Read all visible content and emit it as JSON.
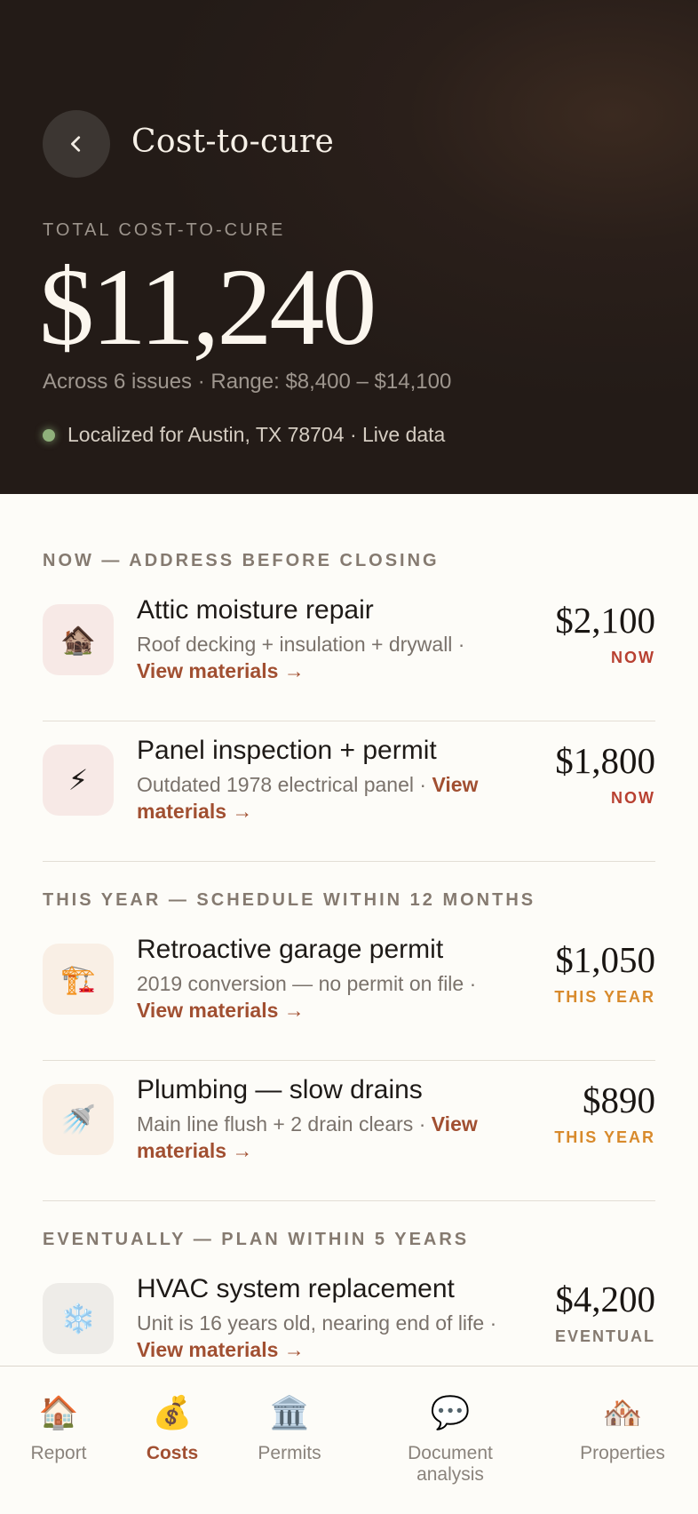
{
  "header": {
    "title": "Cost-to-cure",
    "total_label": "TOTAL COST-TO-CURE",
    "total_amount": "$11,240",
    "summary": "Across 6 issues · Range: $8,400 – $14,100",
    "location": "Localized for Austin, TX 78704 · Live data"
  },
  "sections": [
    {
      "heading": "NOW — ADDRESS BEFORE CLOSING"
    },
    {
      "heading": "THIS YEAR — SCHEDULE WITHIN 12 MONTHS"
    },
    {
      "heading": "EVENTUALLY — PLAN WITHIN 5 YEARS"
    }
  ],
  "items": [
    {
      "icon": "🏚️",
      "icon_name": "house-icon",
      "name": "Attic moisture repair",
      "description": "Roof decking + insulation + drywall ·",
      "link": "View materials →",
      "price": "$2,100",
      "timing": "NOW",
      "timing_color": "#b84031",
      "tile_color": "#f7e9e6"
    },
    {
      "icon": "⚡",
      "icon_name": "lightning-icon",
      "name": "Panel inspection + permit",
      "description": "Outdated 1978 electrical panel ·",
      "link": "View materials →",
      "price": "$1,800",
      "timing": "NOW",
      "timing_color": "#b84031",
      "tile_color": "#f7e9e6"
    },
    {
      "icon": "🏗️",
      "icon_name": "construction-icon",
      "name": "Retroactive garage permit",
      "description": "2019 conversion — no permit on file ·",
      "link": "View materials →",
      "price": "$1,050",
      "timing": "THIS YEAR",
      "timing_color": "#d88a2c",
      "tile_color": "#f9efe5"
    },
    {
      "icon": "🚿",
      "icon_name": "shower-icon",
      "name": "Plumbing — slow drains",
      "description": "Main line flush + 2 drain clears ·",
      "link": "View materials →",
      "price": "$890",
      "timing": "THIS YEAR",
      "timing_color": "#d88a2c",
      "tile_color": "#f9efe5"
    },
    {
      "icon": "❄️",
      "icon_name": "snowflake-icon",
      "name": "HVAC system replacement",
      "description": "Unit is 16 years old, nearing end of life ·",
      "link": "View materials →",
      "price": "$4,200",
      "timing": "EVENTUAL",
      "timing_color": "#857a70",
      "tile_color": "#eeece8"
    }
  ],
  "tabs": [
    {
      "icon": "🏠",
      "icon_name": "house-icon",
      "label": "Report",
      "active": false
    },
    {
      "icon": "💰",
      "icon_name": "money-bag-icon",
      "label": "Costs",
      "active": true
    },
    {
      "icon": "🏛️",
      "icon_name": "building-icon",
      "label": "Permits",
      "active": false
    },
    {
      "icon": "💬",
      "icon_name": "speech-bubble-icon",
      "label": "Document analysis",
      "active": false
    },
    {
      "icon": "🏘️",
      "icon_name": "houses-icon",
      "label": "Properties",
      "active": false
    }
  ]
}
